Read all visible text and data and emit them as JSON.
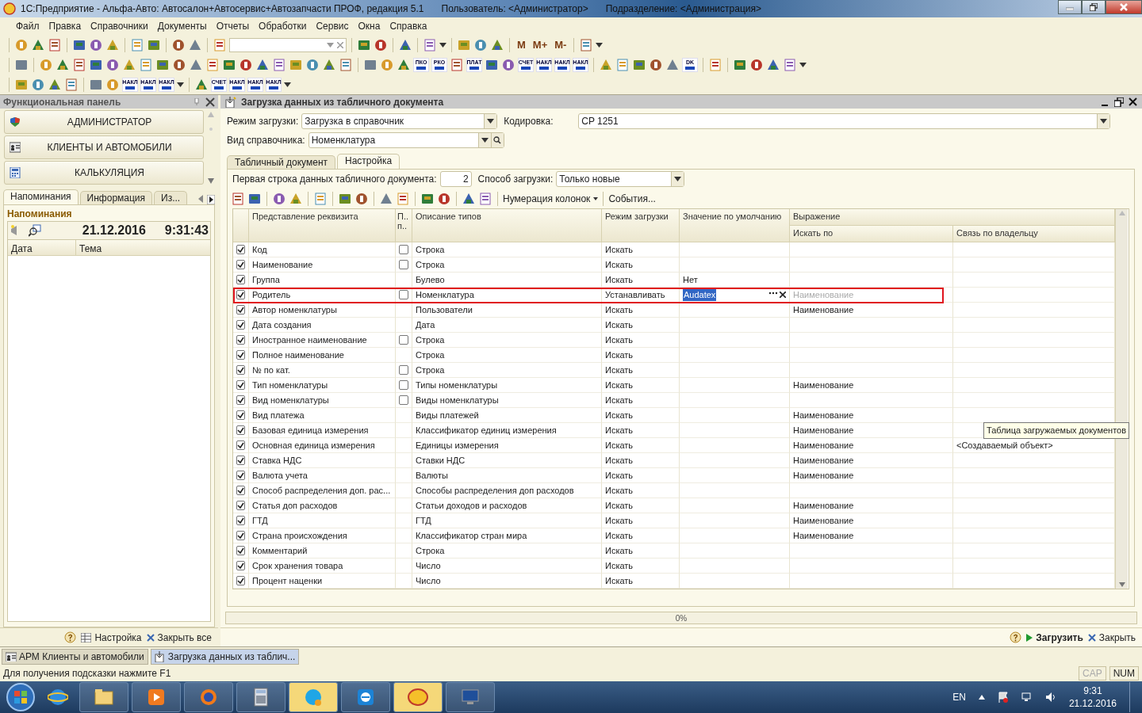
{
  "window": {
    "title": "1С:Предприятие - Альфа-Авто: Автосалон+Автосервис+Автозапчасти ПРОФ, редакция 5.1",
    "user": "Пользователь: <Администратор>",
    "division": "Подразделение: <Администрация>"
  },
  "menu": [
    "Файл",
    "Правка",
    "Справочники",
    "Документы",
    "Отчеты",
    "Обработки",
    "Сервис",
    "Окна",
    "Справка"
  ],
  "toolbar_1": {
    "labels": [
      "M",
      "M+",
      "M-"
    ]
  },
  "toolbar_2": {
    "labels": [
      "ПКО",
      "РКО",
      "ПЛАТ",
      "СЧЕТ",
      "НАКЛ",
      "НАКЛ",
      "НАКЛ",
      "DK"
    ]
  },
  "toolbar_3": {
    "labels": [
      "НАКЛ",
      "НАКЛ",
      "НАКЛ",
      "СЧЕТ",
      "НАКЛ",
      "НАКЛ",
      "НАКЛ"
    ]
  },
  "function_panel": {
    "title": "Функциональная панель",
    "sections": [
      "АДМИНИСТРАТОР",
      "КЛИЕНТЫ И АВТОМОБИЛИ",
      "КАЛЬКУЛЯЦИЯ"
    ],
    "tabs": [
      {
        "label": "Напоминания",
        "selected": true
      },
      {
        "label": "Информация",
        "selected": false
      },
      {
        "label": "Из...",
        "selected": false
      }
    ],
    "heading": "Напоминания",
    "date": "21.12.2016",
    "time": "9:31:43",
    "columns": [
      "Дата",
      "Тема"
    ],
    "footer": [
      "Настройка",
      "Закрыть все"
    ]
  },
  "form": {
    "title": "Загрузка данных из табличного документа",
    "mode_label": "Режим загрузки:",
    "mode_value": "Загрузка в справочник",
    "encoding_label": "Кодировка:",
    "encoding_value": "CP 1251",
    "catalog_label": "Вид справочника:",
    "catalog_value": "Номенклатура",
    "tabs": [
      {
        "label": "Табличный документ",
        "selected": false
      },
      {
        "label": "Настройка",
        "selected": true
      }
    ],
    "first_row_label": "Первая строка данных табличного документа:",
    "first_row_value": "2",
    "method_label": "Способ загрузки:",
    "method_value": "Только новые",
    "toolbar": [
      "Нумерация колонок",
      "События..."
    ],
    "columns": [
      "Представление реквизита",
      "П.. п..",
      "Описание типов",
      "Режим загрузки",
      "Значение по умолчанию",
      "Выражение",
      "Искать по",
      "Связь по владельцу"
    ],
    "rows": [
      {
        "name": "Код",
        "checked": true,
        "p_checkbox": true,
        "type": "Строка",
        "mode": "Искать",
        "default": "",
        "search_by": "",
        "owner_link": "",
        "selected": false
      },
      {
        "name": "Наименование",
        "checked": true,
        "p_checkbox": true,
        "type": "Строка",
        "mode": "Искать",
        "default": "",
        "search_by": "",
        "owner_link": "",
        "selected": false
      },
      {
        "name": "Группа",
        "checked": true,
        "p_checkbox": false,
        "type": "Булево",
        "mode": "Искать",
        "default": "Нет",
        "search_by": "",
        "owner_link": "",
        "selected": false
      },
      {
        "name": "Родитель",
        "checked": true,
        "p_checkbox": true,
        "type": "Номенклатура",
        "mode": "Устанавливать",
        "default": "Audatex",
        "search_by": "Наименование",
        "owner_link": "",
        "selected": true
      },
      {
        "name": "Автор номенклатуры",
        "checked": true,
        "p_checkbox": false,
        "type": "Пользователи",
        "mode": "Искать",
        "default": "",
        "search_by": "Наименование",
        "owner_link": "",
        "selected": false
      },
      {
        "name": "Дата создания",
        "checked": true,
        "p_checkbox": false,
        "type": "Дата",
        "mode": "Искать",
        "default": "",
        "search_by": "",
        "owner_link": "",
        "selected": false
      },
      {
        "name": "Иностранное наименование",
        "checked": true,
        "p_checkbox": true,
        "type": "Строка",
        "mode": "Искать",
        "default": "",
        "search_by": "",
        "owner_link": "",
        "selected": false
      },
      {
        "name": "Полное наименование",
        "checked": true,
        "p_checkbox": false,
        "type": "Строка",
        "mode": "Искать",
        "default": "",
        "search_by": "",
        "owner_link": "",
        "selected": false
      },
      {
        "name": "№ по кат.",
        "checked": true,
        "p_checkbox": true,
        "type": "Строка",
        "mode": "Искать",
        "default": "",
        "search_by": "",
        "owner_link": "",
        "selected": false
      },
      {
        "name": "Тип номенклатуры",
        "checked": true,
        "p_checkbox": true,
        "type": "Типы номенклатуры",
        "mode": "Искать",
        "default": "",
        "search_by": "Наименование",
        "owner_link": "",
        "selected": false
      },
      {
        "name": "Вид номенклатуры",
        "checked": true,
        "p_checkbox": true,
        "type": "Виды номенклатуры",
        "mode": "Искать",
        "default": "",
        "search_by": "",
        "owner_link": "",
        "selected": false
      },
      {
        "name": "Вид платежа",
        "checked": true,
        "p_checkbox": false,
        "type": "Виды платежей",
        "mode": "Искать",
        "default": "",
        "search_by": "Наименование",
        "owner_link": "",
        "selected": false
      },
      {
        "name": "Базовая единица измерения",
        "checked": true,
        "p_checkbox": false,
        "type": "Классификатор единиц измерения",
        "mode": "Искать",
        "default": "",
        "search_by": "Наименование",
        "owner_link": "",
        "selected": false
      },
      {
        "name": "Основная единица измерения",
        "checked": true,
        "p_checkbox": false,
        "type": "Единицы измерения",
        "mode": "Искать",
        "default": "",
        "search_by": "Наименование",
        "owner_link": "<Создаваемый объект>",
        "selected": false
      },
      {
        "name": "Ставка НДС",
        "checked": true,
        "p_checkbox": false,
        "type": "Ставки НДС",
        "mode": "Искать",
        "default": "",
        "search_by": "Наименование",
        "owner_link": "",
        "selected": false
      },
      {
        "name": "Валюта учета",
        "checked": true,
        "p_checkbox": false,
        "type": "Валюты",
        "mode": "Искать",
        "default": "",
        "search_by": "Наименование",
        "owner_link": "",
        "selected": false
      },
      {
        "name": "Способ распределения доп. рас...",
        "checked": true,
        "p_checkbox": false,
        "type": "Способы распределения доп расходов",
        "mode": "Искать",
        "default": "",
        "search_by": "",
        "owner_link": "",
        "selected": false
      },
      {
        "name": "Статья доп расходов",
        "checked": true,
        "p_checkbox": false,
        "type": "Статьи доходов и расходов",
        "mode": "Искать",
        "default": "",
        "search_by": "Наименование",
        "owner_link": "",
        "selected": false
      },
      {
        "name": "ГТД",
        "checked": true,
        "p_checkbox": false,
        "type": "ГТД",
        "mode": "Искать",
        "default": "",
        "search_by": "Наименование",
        "owner_link": "",
        "selected": false
      },
      {
        "name": "Страна происхождения",
        "checked": true,
        "p_checkbox": false,
        "type": "Классификатор стран мира",
        "mode": "Искать",
        "default": "",
        "search_by": "Наименование",
        "owner_link": "",
        "selected": false
      },
      {
        "name": "Комментарий",
        "checked": true,
        "p_checkbox": false,
        "type": "Строка",
        "mode": "Искать",
        "default": "",
        "search_by": "",
        "owner_link": "",
        "selected": false
      },
      {
        "name": "Срок хранения товара",
        "checked": true,
        "p_checkbox": false,
        "type": "Число",
        "mode": "Искать",
        "default": "",
        "search_by": "",
        "owner_link": "",
        "selected": false
      },
      {
        "name": "Процент наценки",
        "checked": true,
        "p_checkbox": false,
        "type": "Число",
        "mode": "Искать",
        "default": "",
        "search_by": "",
        "owner_link": "",
        "selected": false
      }
    ],
    "tooltip": "Таблица загружаемых документов",
    "progress": {
      "level": 0,
      "reading": "0%"
    },
    "buttons": [
      "Загрузить",
      "Закрыть"
    ]
  },
  "window_tabs": [
    {
      "label": "АРМ Клиенты и автомобили",
      "selected": false
    },
    {
      "label": "Загрузка данных из таблич...",
      "selected": true
    }
  ],
  "status_bar": {
    "hint": "Для получения подсказки нажмите F1",
    "indicators": [
      {
        "label": "CAP",
        "on": false
      },
      {
        "label": "NUM",
        "on": true
      }
    ]
  },
  "taskbar": {
    "language": "EN",
    "time": "9:31",
    "date": "21.12.2016"
  }
}
